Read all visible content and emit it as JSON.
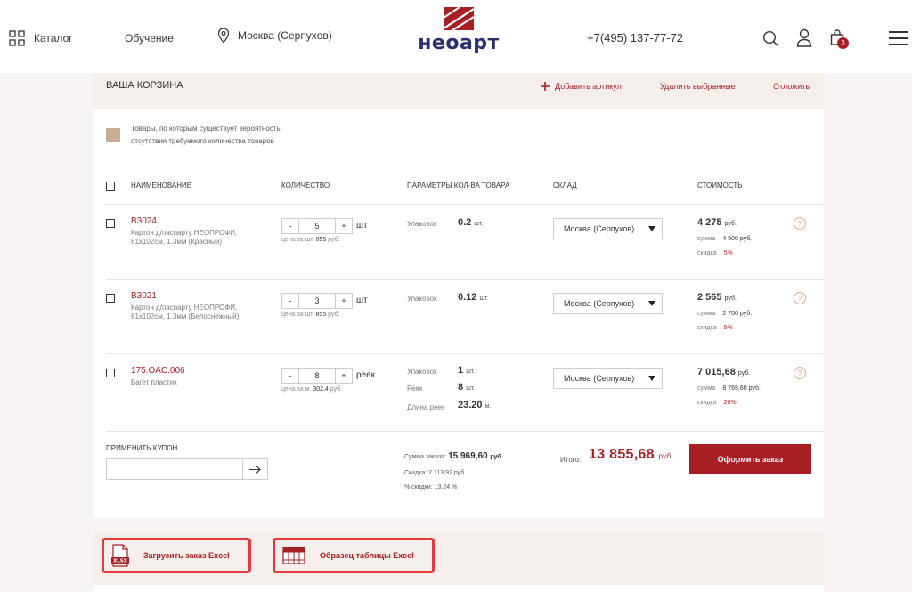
{
  "header": {
    "catalog_label": "Каталог",
    "learning_label": "Обучение",
    "city_label": "Москва (Серпухов)",
    "brand": "неоарт",
    "phone": "+7(495) 137-77-72",
    "cart_count": "3"
  },
  "cart": {
    "title": "ВАША КОРЗИНА",
    "add_article": "Добавить артикул",
    "delete_selected": "Удалить выбранные",
    "postpone": "Отложить",
    "legend": "Товары, по которым существует вероятность отсутствия требуемого количества товаров",
    "columns": {
      "name": "НАИМЕНОВАНИЕ",
      "qty": "КОЛИЧЕСТВО",
      "params": "ПАРАМЕТРЫ КОЛ-ВА ТОВАРА",
      "stock": "СКЛАД",
      "cost": "СТОИМОСТЬ"
    },
    "items": [
      {
        "sku": "B3024",
        "name": "Картон д/паспарту НЕОПРОФИ, 81x102см, 1.3мм (Красный)",
        "qty": "5",
        "unit": "шт",
        "price_label": "цена за шт.",
        "price": "855",
        "price_unit": "руб.",
        "params": [
          {
            "label": "Упаковок",
            "value": "0.2",
            "unit": "шт."
          }
        ],
        "stock": "Москва (Серпухов)",
        "cost": "4 275",
        "cost_unit": "руб.",
        "sum_label": "сумма",
        "sum": "4 500 руб.",
        "discount_label": "скидка",
        "discount": "5%"
      },
      {
        "sku": "B3021",
        "name": "Картон д/паспарту НЕОПРОФИ, 81x102см, 1.3мм (Белоснежный)",
        "qty": "3",
        "unit": "шт",
        "price_label": "цена за шт.",
        "price": "855",
        "price_unit": "руб.",
        "params": [
          {
            "label": "Упаковок",
            "value": "0.12",
            "unit": "шт."
          }
        ],
        "stock": "Москва (Серпухов)",
        "cost": "2 565",
        "cost_unit": "руб.",
        "sum_label": "сумма",
        "sum": "2 700 руб.",
        "discount_label": "скидка",
        "discount": "5%"
      },
      {
        "sku": "175.OAC.006",
        "name": "Багет пластик",
        "qty": "8",
        "unit": "реек",
        "price_label": "цена за м.",
        "price": "302.4",
        "price_unit": "руб.",
        "params": [
          {
            "label": "Упаковок",
            "value": "1",
            "unit": "шт."
          },
          {
            "label": "Реек",
            "value": "8",
            "unit": "шт."
          },
          {
            "label": "Длина реек",
            "value": "23.20",
            "unit": "м."
          }
        ],
        "stock": "Москва (Серпухов)",
        "cost": "7 015,68",
        "cost_unit": "руб.",
        "sum_label": "сумма",
        "sum": "8 769,60 руб.",
        "discount_label": "скидка",
        "discount": "20%"
      }
    ],
    "coupon_label": "ПРИМЕНИТЬ КУПОН",
    "summary": {
      "order_sum_label": "Сумма заказа:",
      "order_sum": "15 969,60",
      "order_sum_unit": "руб.",
      "discount_label": "Скидка:",
      "discount": "2 113,92 руб.",
      "discount_pct_label": "% скидки:",
      "discount_pct": "13.24 %",
      "total_label": "Итого:",
      "total": "13 855,68",
      "total_unit": "руб"
    },
    "order_button": "Оформить заказ"
  },
  "bottom": {
    "upload_excel": "Загрузить заказ Excel",
    "excel_sample": "Образец таблицы Excel",
    "xlsx_label": "XLSX"
  },
  "colors": {
    "accent": "#a81f23",
    "brand_blue": "#2a2f6e",
    "legend": "#c7ad94",
    "highlight_border": "#e33b3b"
  }
}
